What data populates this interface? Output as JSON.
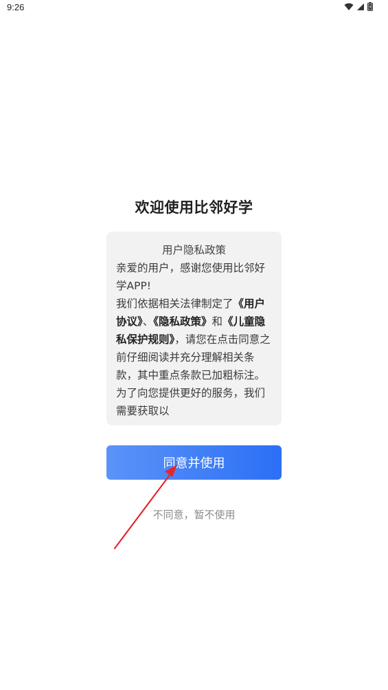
{
  "status_bar": {
    "time": "9:26",
    "icons": [
      "wifi-icon",
      "signal-icon",
      "battery-icon"
    ]
  },
  "dialog": {
    "title": "欢迎使用比邻好学",
    "policy": {
      "heading": "用户隐私政策",
      "greeting": "亲爱的用户，感谢您使用比邻好学APP!",
      "body_intro": "我们依据相关法律制定了",
      "link_user_agreement": "《用户协议》",
      "separator": "、",
      "link_privacy_policy": "《隐私政策》",
      "and_word": "和",
      "link_child_privacy": "《儿童隐私保护规则》",
      "body_rest": "，请您在点击同意之前仔细阅读并充分理解相关条款，其中重点条款已加粗标注。为了向您提供更好的服务，我们需要获取以"
    },
    "agree_label": "同意并使用",
    "disagree_label": "不同意，暂不使用"
  },
  "colors": {
    "button_gradient_start": "#5b93f8",
    "button_gradient_end": "#2c6ff5",
    "annotation_arrow": "#e8262a"
  }
}
